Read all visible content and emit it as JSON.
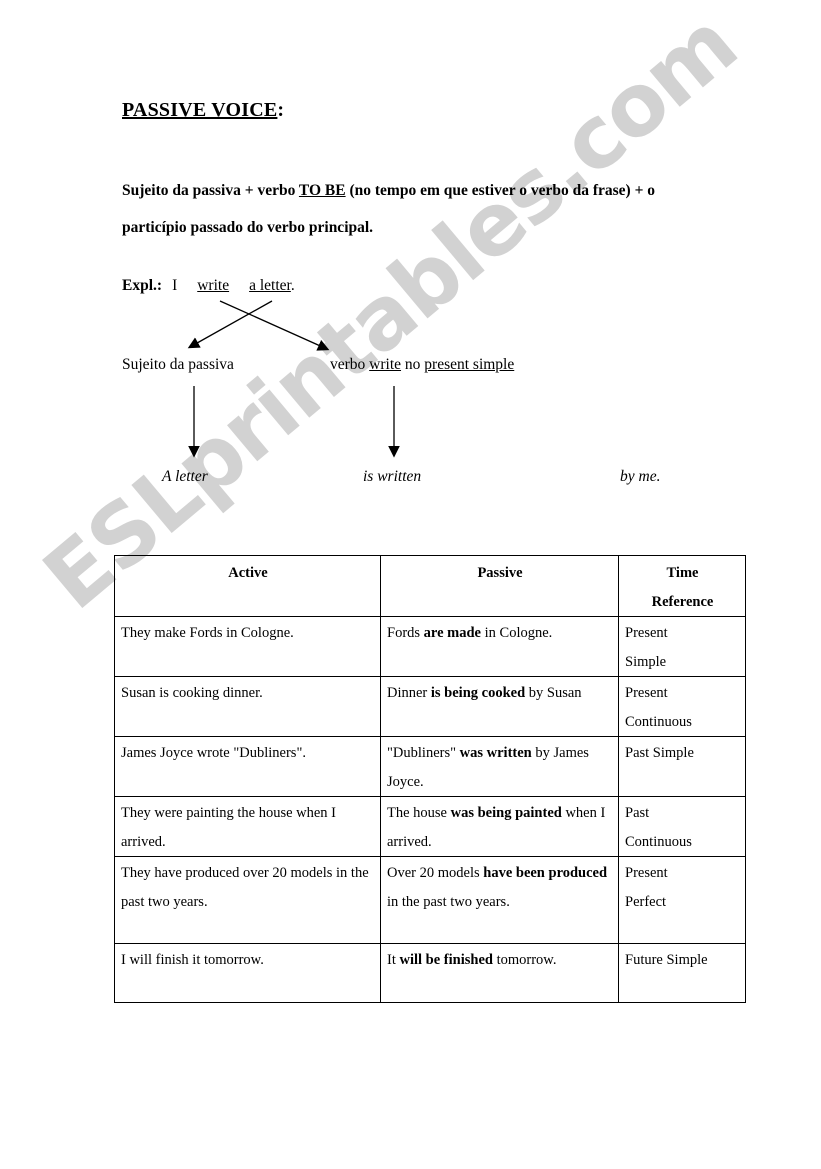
{
  "watermark": {
    "text": "ESLprintables.com",
    "color": "#d2d2d2"
  },
  "heading": {
    "underlined": "PASSIVE VOICE",
    "colon": ":"
  },
  "rule": {
    "part1": "Sujeito da passiva + verbo ",
    "to_be": "TO BE",
    "part2": " (no tempo em que estiver o verbo da frase) + o particípio passado do verbo principal."
  },
  "example": {
    "label": "Expl.:",
    "subject": "I",
    "verb": "write",
    "object": "a letter",
    "period": "."
  },
  "diagram": {
    "left_label": "Sujeito da passiva",
    "right_label_pre": "verbo ",
    "right_label_verb": "write",
    "right_label_mid": " no ",
    "right_label_tense": "present simple",
    "result_subject": "A letter",
    "result_verb": "is written",
    "result_agent": "by me."
  },
  "table": {
    "headers": {
      "active": "Active",
      "passive": "Passive",
      "time_line1": "Time",
      "time_line2": "Reference"
    },
    "rows": [
      {
        "active": "They make Fords in Cologne.",
        "passive_pre": "Fords ",
        "passive_bold": "are made",
        "passive_post": " in Cologne.",
        "time_line1": "Present",
        "time_line2": "Simple"
      },
      {
        "active": "Susan is cooking dinner.",
        "passive_pre": "Dinner ",
        "passive_bold": "is being cooked",
        "passive_post": " by Susan",
        "time_line1": "Present",
        "time_line2": "Continuous"
      },
      {
        "active": "James Joyce wrote \"Dubliners\".",
        "passive_pre": "\"Dubliners\" ",
        "passive_bold": "was written",
        "passive_post": " by James Joyce.",
        "time_line1": "Past Simple",
        "time_line2": ""
      },
      {
        "active": "They were painting the house when I arrived.",
        "passive_pre": "The house ",
        "passive_bold": "was being painted",
        "passive_post": " when I arrived.",
        "time_line1": "Past",
        "time_line2": "Continuous"
      },
      {
        "active": "They have produced over 20 models in the past two years.",
        "passive_pre": "Over 20 models ",
        "passive_bold": "have been produced",
        "passive_post": " in the past two years.",
        "time_line1": "Present",
        "time_line2": "Perfect"
      },
      {
        "active": "I will finish it tomorrow.",
        "passive_pre": "It ",
        "passive_bold": "will be finished",
        "passive_post": " tomorrow.",
        "time_line1": "Future Simple",
        "time_line2": ""
      }
    ]
  }
}
